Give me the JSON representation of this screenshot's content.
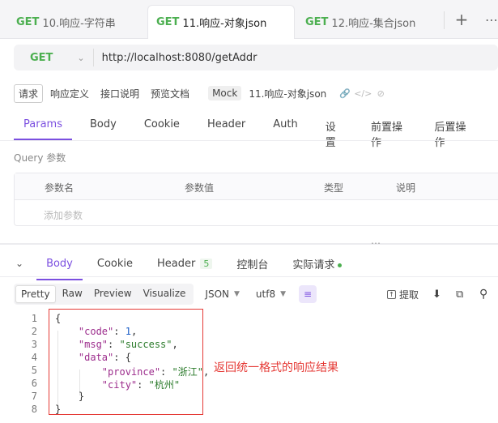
{
  "tabs": [
    {
      "method": "GET",
      "label": "10.响应-字符串"
    },
    {
      "method": "GET",
      "label": "11.响应-对象json"
    },
    {
      "method": "GET",
      "label": "12.响应-集合json"
    }
  ],
  "tab_actions": {
    "add": "+",
    "more": "⋯"
  },
  "url_bar": {
    "method": "GET",
    "url": "http://localhost:8080/getAddr"
  },
  "sub_toolbar": {
    "items": [
      "请求",
      "响应定义",
      "接口说明",
      "预览文档",
      "Mock"
    ],
    "name": "11.响应-对象json"
  },
  "param_tabs": [
    "Params",
    "Body",
    "Cookie",
    "Header",
    "Auth",
    "设置",
    "前置操作",
    "后置操作"
  ],
  "query": {
    "label": "Query 参数",
    "columns": [
      "参数名",
      "参数值",
      "类型",
      "说明"
    ],
    "add_placeholder": "添加参数"
  },
  "response_tabs": {
    "items": [
      "Body",
      "Cookie",
      "Header",
      "控制台",
      "实际请求"
    ],
    "header_count": "5"
  },
  "response_toolbar": {
    "formats": [
      "Pretty",
      "Raw",
      "Preview",
      "Visualize"
    ],
    "format_select": "JSON",
    "encoding_select": "utf8",
    "extract_label": "提取"
  },
  "code_lines": [
    {
      "num": "1",
      "text": "{"
    },
    {
      "num": "2",
      "text": "    \"code\": 1,"
    },
    {
      "num": "3",
      "text": "    \"msg\": \"success\","
    },
    {
      "num": "4",
      "text": "    \"data\": {"
    },
    {
      "num": "5",
      "text": "        \"province\": \"浙江\","
    },
    {
      "num": "6",
      "text": "        \"city\": \"杭州\""
    },
    {
      "num": "7",
      "text": "    }"
    },
    {
      "num": "8",
      "text": "}"
    }
  ],
  "annotation": "返回统一格式的响应结果",
  "colors": {
    "accent": "#7b4fe0",
    "get_method": "#4caf50",
    "annotation": "#e53935"
  }
}
